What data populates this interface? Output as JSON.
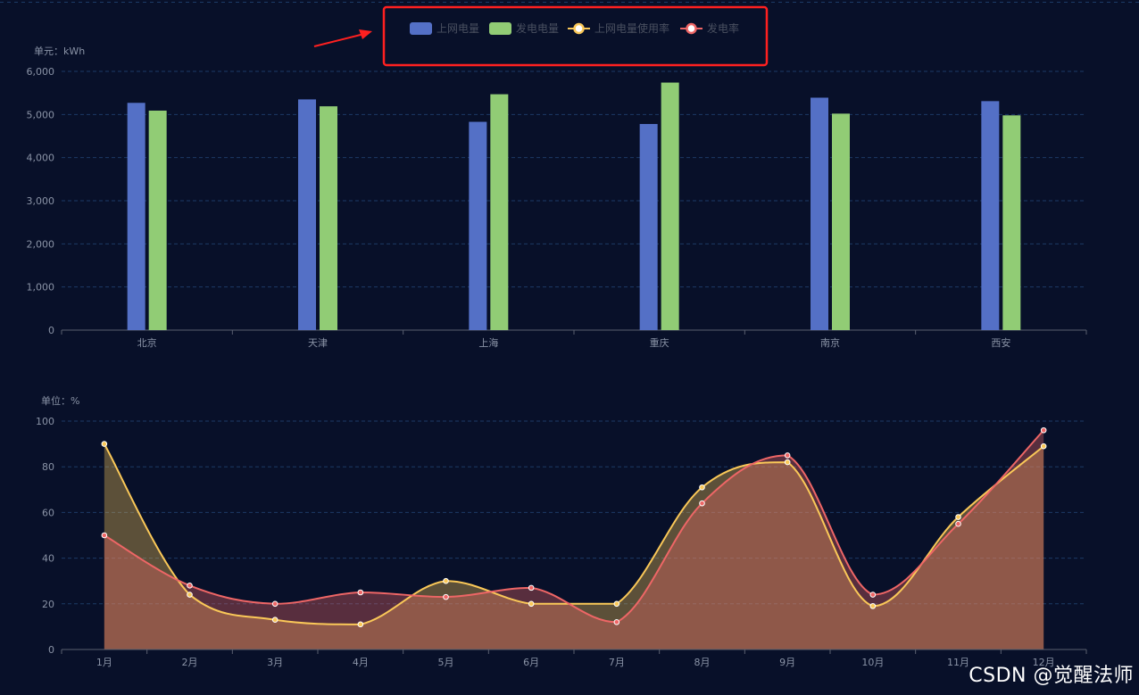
{
  "colors": {
    "bg": "#081029",
    "grid": "#1c3a66",
    "axis": "#5a6070",
    "tick": "#8a93a6",
    "grid_power": "#5470c6",
    "gen_power": "#91cc75",
    "grid_rate": "#fac858",
    "gen_rate": "#ee6666",
    "highlight_box": "#ff2020",
    "arrow": "#ff2020"
  },
  "legend": [
    {
      "label": "上网电量",
      "type": "bar",
      "color": "#5470c6"
    },
    {
      "label": "发电电量",
      "type": "bar",
      "color": "#91cc75"
    },
    {
      "label": "上网电量使用率",
      "type": "line",
      "color": "#fac858"
    },
    {
      "label": "发电率",
      "type": "line",
      "color": "#ee6666"
    }
  ],
  "chart_data": [
    {
      "type": "bar",
      "unit_label": "单元：kWh",
      "categories": [
        "北京",
        "天津",
        "上海",
        "重庆",
        "南京",
        "西安"
      ],
      "yticks": [
        "0",
        "1,000",
        "2,000",
        "3,000",
        "4,000",
        "5,000",
        "6,000"
      ],
      "ylim": [
        0,
        6000
      ],
      "series": [
        {
          "name": "上网电量",
          "values": [
            5270,
            5350,
            4830,
            4780,
            5390,
            5310
          ]
        },
        {
          "name": "发电电量",
          "values": [
            5090,
            5190,
            5470,
            5740,
            5020,
            4980
          ]
        }
      ]
    },
    {
      "type": "area",
      "unit_label": "单位：%",
      "categories": [
        "1月",
        "2月",
        "3月",
        "4月",
        "5月",
        "6月",
        "7月",
        "8月",
        "9月",
        "10月",
        "11月",
        "12月"
      ],
      "yticks": [
        "0",
        "20",
        "40",
        "60",
        "80",
        "100"
      ],
      "ylim": [
        0,
        100
      ],
      "series": [
        {
          "name": "上网电量使用率",
          "values": [
            90,
            24,
            13,
            11,
            30,
            20,
            20,
            71,
            82,
            19,
            58,
            89
          ]
        },
        {
          "name": "发电率",
          "values": [
            50,
            28,
            20,
            25,
            23,
            27,
            12,
            64,
            85,
            24,
            55,
            96
          ]
        }
      ]
    }
  ],
  "watermark": "CSDN @觉醒法师"
}
